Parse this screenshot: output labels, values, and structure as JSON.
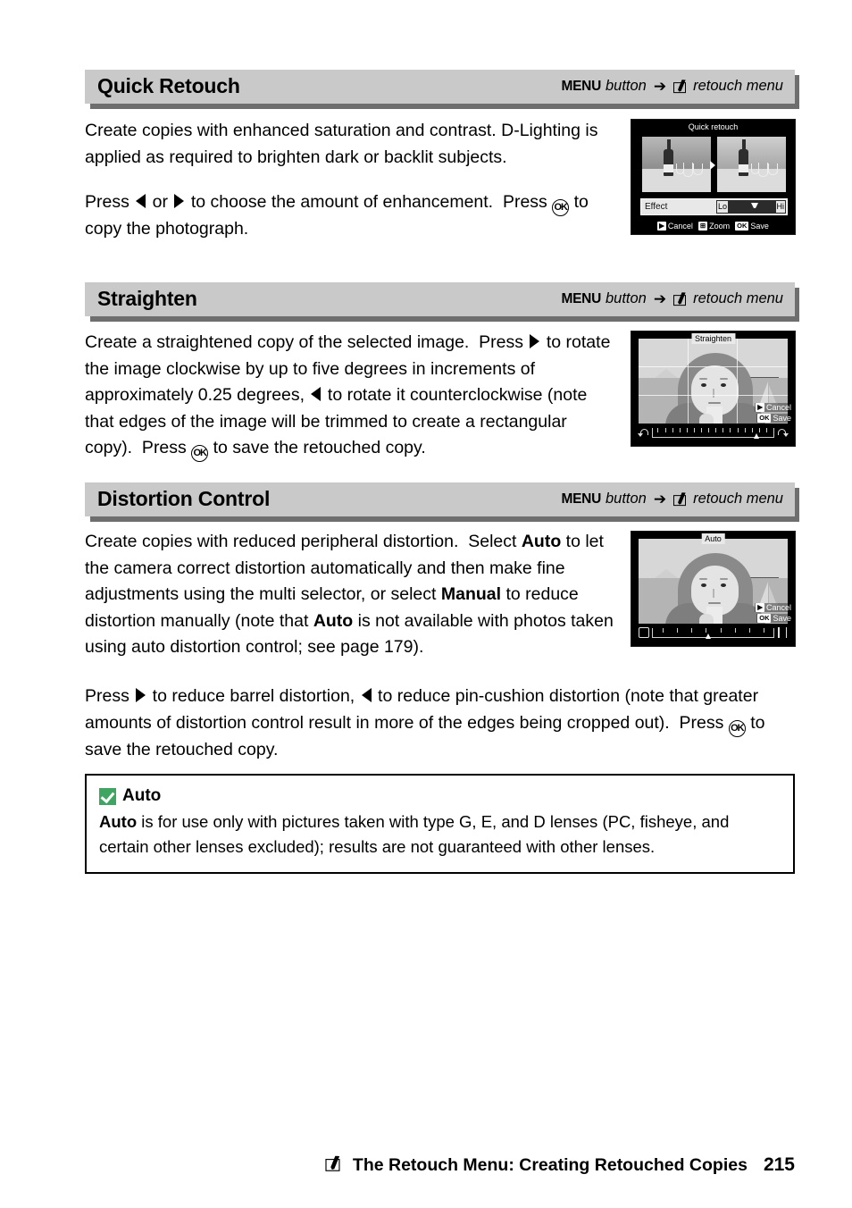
{
  "sections": [
    {
      "title": "Quick Retouch",
      "path": {
        "menu_word": "MENU",
        "button_word": "button",
        "arrow": "➔",
        "target": "retouch menu",
        "icon": "retouch-pen-icon"
      },
      "paragraphs": [
        "Create copies with enhanced saturation and contrast. D-Lighting is applied as required to brighten dark or backlit subjects.",
        "Press ◀ or ▶ to choose the amount of enhancement.  Press Ⓚ to copy the photograph."
      ],
      "screen": {
        "title": "Quick retouch",
        "effect_label": "Effect",
        "slider_low": "Lo",
        "slider_high": "Hi",
        "hints": [
          {
            "key": "▶",
            "label": "Cancel"
          },
          {
            "key": "⊞",
            "label": "Zoom"
          },
          {
            "key": "OK",
            "label": "Save"
          }
        ]
      }
    },
    {
      "title": "Straighten",
      "path": {
        "menu_word": "MENU",
        "button_word": "button",
        "arrow": "➔",
        "target": "retouch menu",
        "icon": "retouch-pen-icon"
      },
      "paragraphs": [
        "Create a straightened copy of the selected image.  Press ▶ to rotate the image clockwise by up to five degrees in increments of approximately 0.25 degrees, ◀ to rotate it counterclockwise (note that edges of the image will be trimmed to create a rectangular copy).  Press Ⓚ to save the retouched copy."
      ],
      "screen": {
        "title": "Straighten",
        "hints": [
          {
            "key": "▶",
            "label": "Cancel"
          },
          {
            "key": "OK",
            "label": "Save"
          }
        ]
      }
    },
    {
      "title": "Distortion Control",
      "path": {
        "menu_word": "MENU",
        "button_word": "button",
        "arrow": "➔",
        "target": "retouch menu",
        "icon": "retouch-pen-icon"
      },
      "paragraphs": [
        "Create copies with reduced peripheral distortion.  Select Auto to let the camera correct distortion automatically and then make fine adjustments using the multi selector, or select Manual to reduce distortion manually (note that Auto is not available with photos taken using auto distortion control; see page 179).",
        "Press ▶ to reduce barrel distortion, ◀ to reduce pin-cushion distortion (note that greater amounts of distortion control result in more of the edges being cropped out).  Press Ⓚ to save the retouched copy."
      ],
      "screen": {
        "title": "Auto",
        "hints": [
          {
            "key": "▶",
            "label": "Cancel"
          },
          {
            "key": "OK",
            "label": "Save"
          }
        ]
      }
    }
  ],
  "note": {
    "icon": "green-check-icon",
    "icon_color": "#3fa562",
    "title": "Auto",
    "body_bold_lead": "Auto",
    "body": " is for use only with pictures taken with type G, E, and D lenses (PC, fisheye, and certain other lenses excluded); results are not guaranteed with other lenses."
  },
  "footer": {
    "icon": "retouch-pen-icon",
    "text": "The Retouch Menu: Creating Retouched Copies",
    "page": "215"
  }
}
